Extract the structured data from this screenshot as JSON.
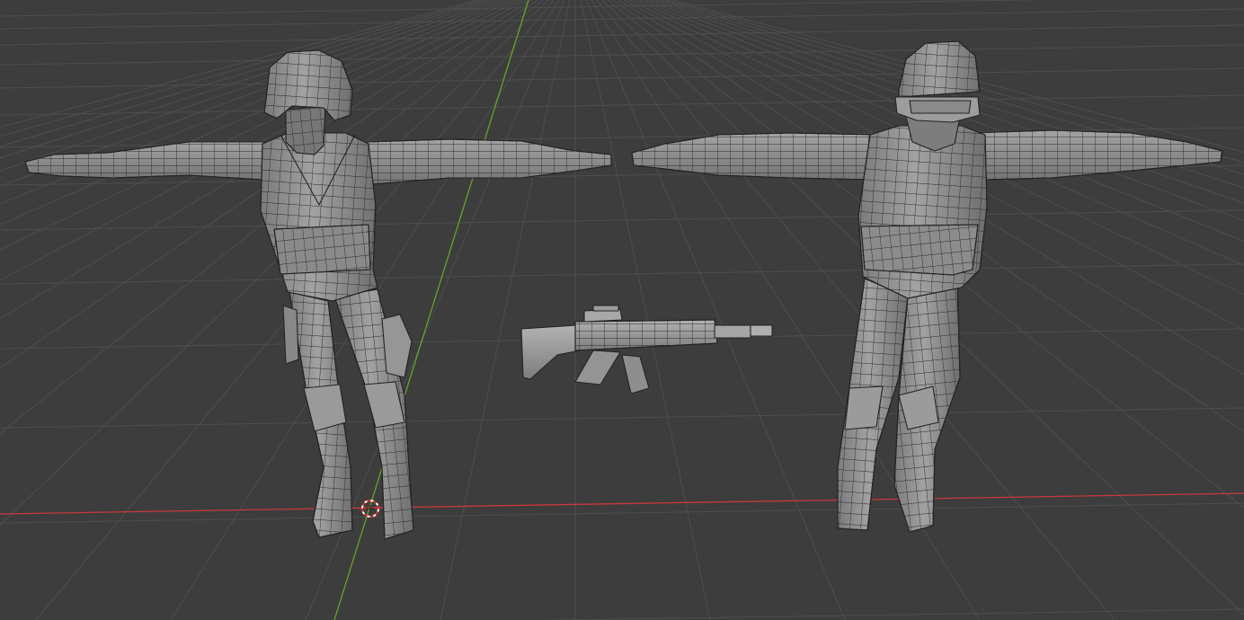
{
  "viewport": {
    "background": "#3d3d3d",
    "grid_color": "#4e4e4e",
    "x_axis_color": "#c8383f",
    "y_axis_color": "#6aa12a",
    "mesh_fill": "#8f8f8f",
    "mesh_wire": "#262626",
    "mode": "solid-wireframe"
  },
  "scene": {
    "objects": [
      {
        "name": "soldier-masked",
        "kind": "character-mesh",
        "pose": "t-pose"
      },
      {
        "name": "assault-rifle",
        "kind": "prop-mesh"
      },
      {
        "name": "soldier-goggles",
        "kind": "character-mesh",
        "pose": "t-pose"
      }
    ],
    "cursor": {
      "icon": "3d-cursor-icon"
    }
  }
}
